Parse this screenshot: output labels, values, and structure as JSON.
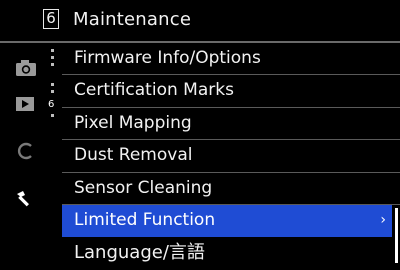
{
  "header": {
    "page_number": "6",
    "title": "Maintenance"
  },
  "sidebar": {
    "tabs": [
      {
        "icon": "camera-icon"
      },
      {
        "icon": "play-icon"
      },
      {
        "icon": "custom-c-icon"
      },
      {
        "icon": "wrench-icon"
      }
    ],
    "page_indicator": "6"
  },
  "menu": {
    "items": [
      {
        "label": "Firmware Info/Options"
      },
      {
        "label": "Certification Marks"
      },
      {
        "label": "Pixel Mapping"
      },
      {
        "label": "Dust Removal"
      },
      {
        "label": "Sensor Cleaning"
      },
      {
        "label": "Limited Function",
        "selected": true,
        "arrow": "›"
      },
      {
        "label": "Language/言語"
      }
    ]
  },
  "colors": {
    "selection": "#1f4cd4",
    "background": "#000000",
    "text": "#f2f2f2"
  }
}
